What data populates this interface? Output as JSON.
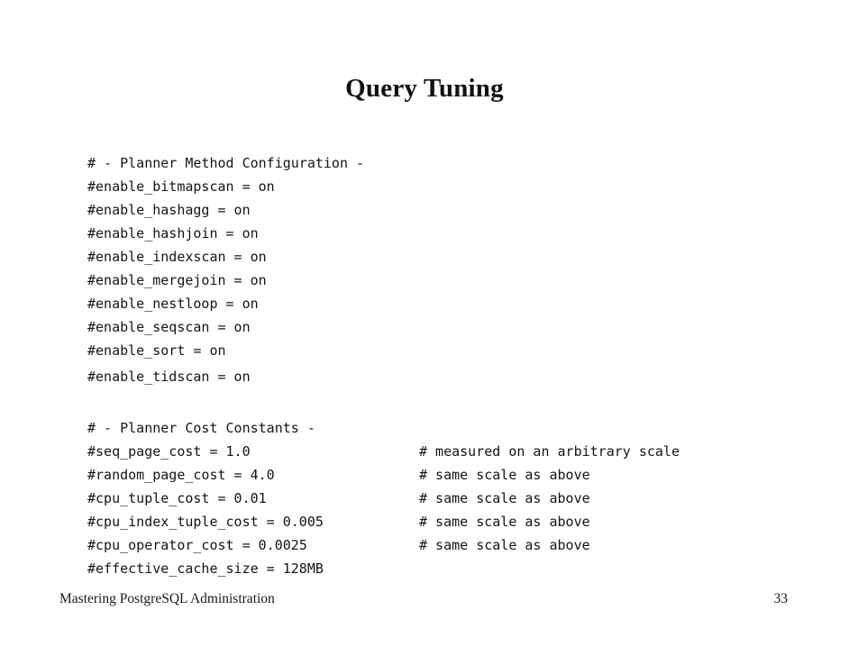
{
  "slide": {
    "title": "Query Tuning",
    "footer": {
      "left": "Mastering PostgreSQL Administration",
      "page_number": "33"
    }
  },
  "planner_method": {
    "header": "# - Planner Method Configuration -",
    "lines": [
      "#enable_bitmapscan = on",
      "#enable_hashagg = on",
      "#enable_hashjoin = on",
      "#enable_indexscan = on",
      "#enable_mergejoin = on",
      "#enable_nestloop = on",
      "#enable_seqscan = on",
      "#enable_sort = on",
      "#enable_tidscan = on"
    ]
  },
  "planner_cost": {
    "header": "# - Planner Cost Constants -",
    "lines": [
      {
        "setting": "#seq_page_cost = 1.0",
        "comment": "# measured on an arbitrary scale"
      },
      {
        "setting": "#random_page_cost = 4.0",
        "comment": "# same scale as above"
      },
      {
        "setting": "#cpu_tuple_cost = 0.01",
        "comment": "# same scale as above"
      },
      {
        "setting": "#cpu_index_tuple_cost = 0.005",
        "comment": "# same scale as above"
      },
      {
        "setting": "#cpu_operator_cost = 0.0025",
        "comment": "# same scale as above"
      },
      {
        "setting": "#effective_cache_size = 128MB",
        "comment": ""
      }
    ]
  }
}
